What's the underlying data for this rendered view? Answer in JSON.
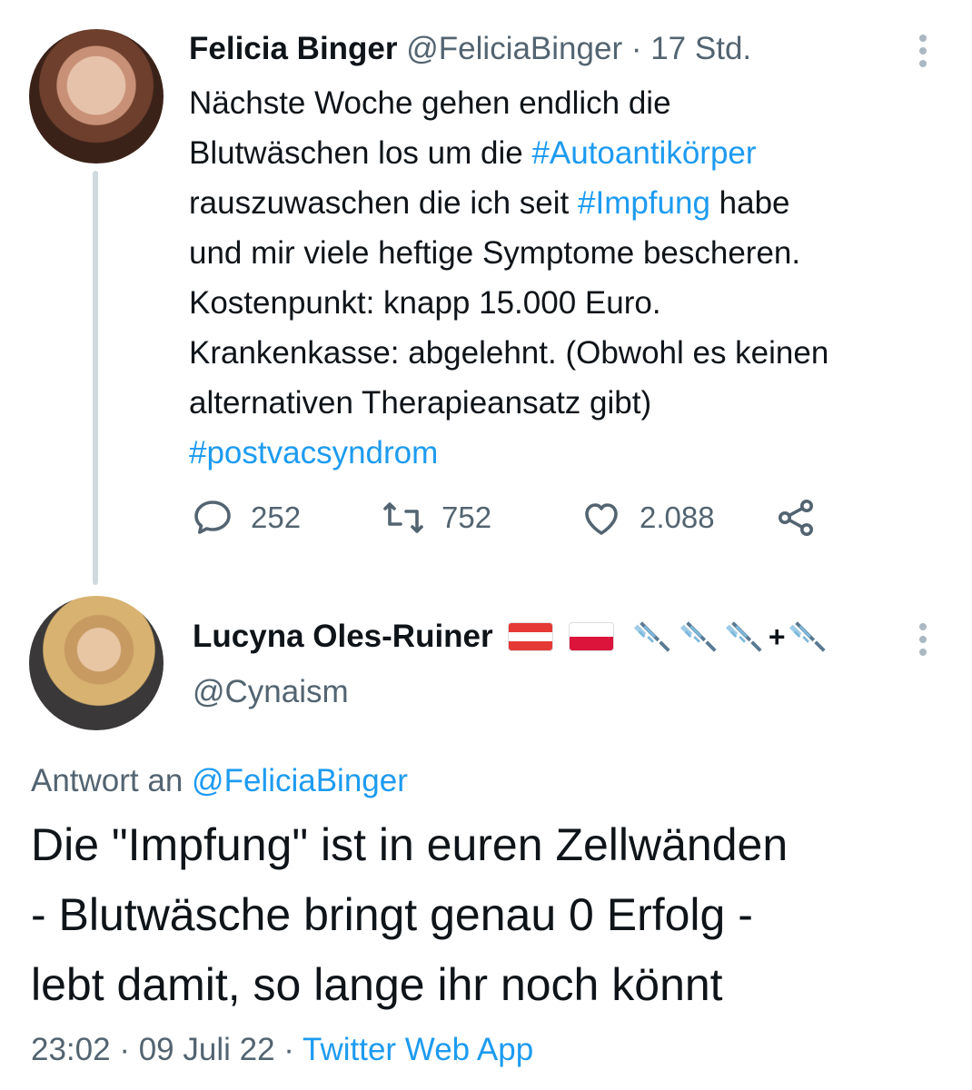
{
  "tweet1": {
    "author_name": "Felicia Binger",
    "author_handle": "@FeliciaBinger",
    "separator": " · ",
    "time": "17 Std.",
    "lines": [
      [
        {
          "t": "Nächste Woche gehen endlich die"
        }
      ],
      [
        {
          "t": "Blutwäschen los um die "
        },
        {
          "t": "#Autoantikörper",
          "h": true
        }
      ],
      [
        {
          "t": "rauszuwaschen die ich seit "
        },
        {
          "t": "#Impfung",
          "h": true
        },
        {
          "t": " habe"
        }
      ],
      [
        {
          "t": "und mir viele heftige Symptome bescheren."
        }
      ],
      [
        {
          "t": "Kostenpunkt: knapp 15.000 Euro."
        }
      ],
      [
        {
          "t": "Krankenkasse: abgelehnt. (Obwohl es keinen"
        }
      ],
      [
        {
          "t": "alternativen Therapieansatz gibt)"
        }
      ],
      [
        {
          "t": "#postvacsyndrom",
          "h": true
        }
      ]
    ],
    "reply_count": "252",
    "retweet_count": "752",
    "like_count": "2.088"
  },
  "tweet2": {
    "author_name": "Lucyna Oles-Ruiner",
    "author_handle": "@Cynaism",
    "emoji_plus": "+",
    "reply_label": "Antwort an ",
    "reply_handle": "@FeliciaBinger",
    "text_lines": [
      "Die \"Impfung\" ist in euren Zellwänden",
      "- Blutwäsche bringt genau 0 Erfolg -",
      "lebt damit, so lange ihr noch könnt"
    ],
    "time": "23:02",
    "date": "09 Juli 22",
    "separator": " · ",
    "source": "Twitter Web App"
  },
  "colors": {
    "link": "#1d9bf0",
    "muted": "#536471",
    "text": "#0f1419"
  },
  "icons": [
    "reply-icon",
    "retweet-icon",
    "like-icon",
    "share-icon",
    "more-icon",
    "austria-flag-icon",
    "poland-flag-icon",
    "syringe-icon"
  ]
}
